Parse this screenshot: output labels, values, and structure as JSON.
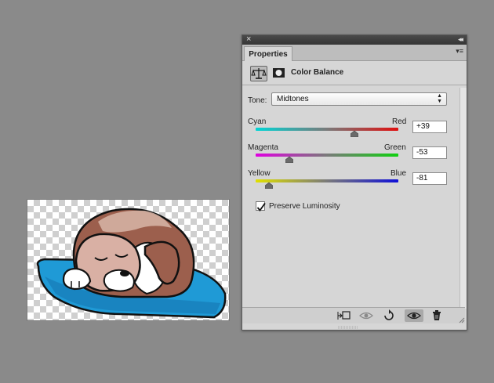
{
  "panel": {
    "tab_label": "Properties",
    "title": "Color Balance",
    "tone_label": "Tone:",
    "tone_value": "Midtones",
    "sliders": [
      {
        "left_label": "Cyan",
        "right_label": "Red",
        "value": "+39",
        "level": 39
      },
      {
        "left_label": "Magenta",
        "right_label": "Green",
        "value": "-53",
        "level": -53
      },
      {
        "left_label": "Yellow",
        "right_label": "Blue",
        "value": "-81",
        "level": -81
      }
    ],
    "preserve_luminosity_label": "Preserve Luminosity",
    "preserve_luminosity_checked": true
  },
  "icons": {
    "close": "close-icon",
    "collapse": "collapse-icon",
    "panel_menu": "panel-menu-icon",
    "adjustment": "balance-scale-icon",
    "mask": "layer-mask-icon",
    "clip": "clip-to-layer-icon",
    "view_previous": "view-previous-state-icon",
    "reset": "reset-icon",
    "visibility": "eye-icon",
    "delete": "trash-icon"
  },
  "colors": {
    "cyan": "#00d5d5",
    "red": "#e01010",
    "magenta": "#e000e0",
    "green": "#10d010",
    "yellow": "#e0e000",
    "blue": "#1010d8"
  }
}
